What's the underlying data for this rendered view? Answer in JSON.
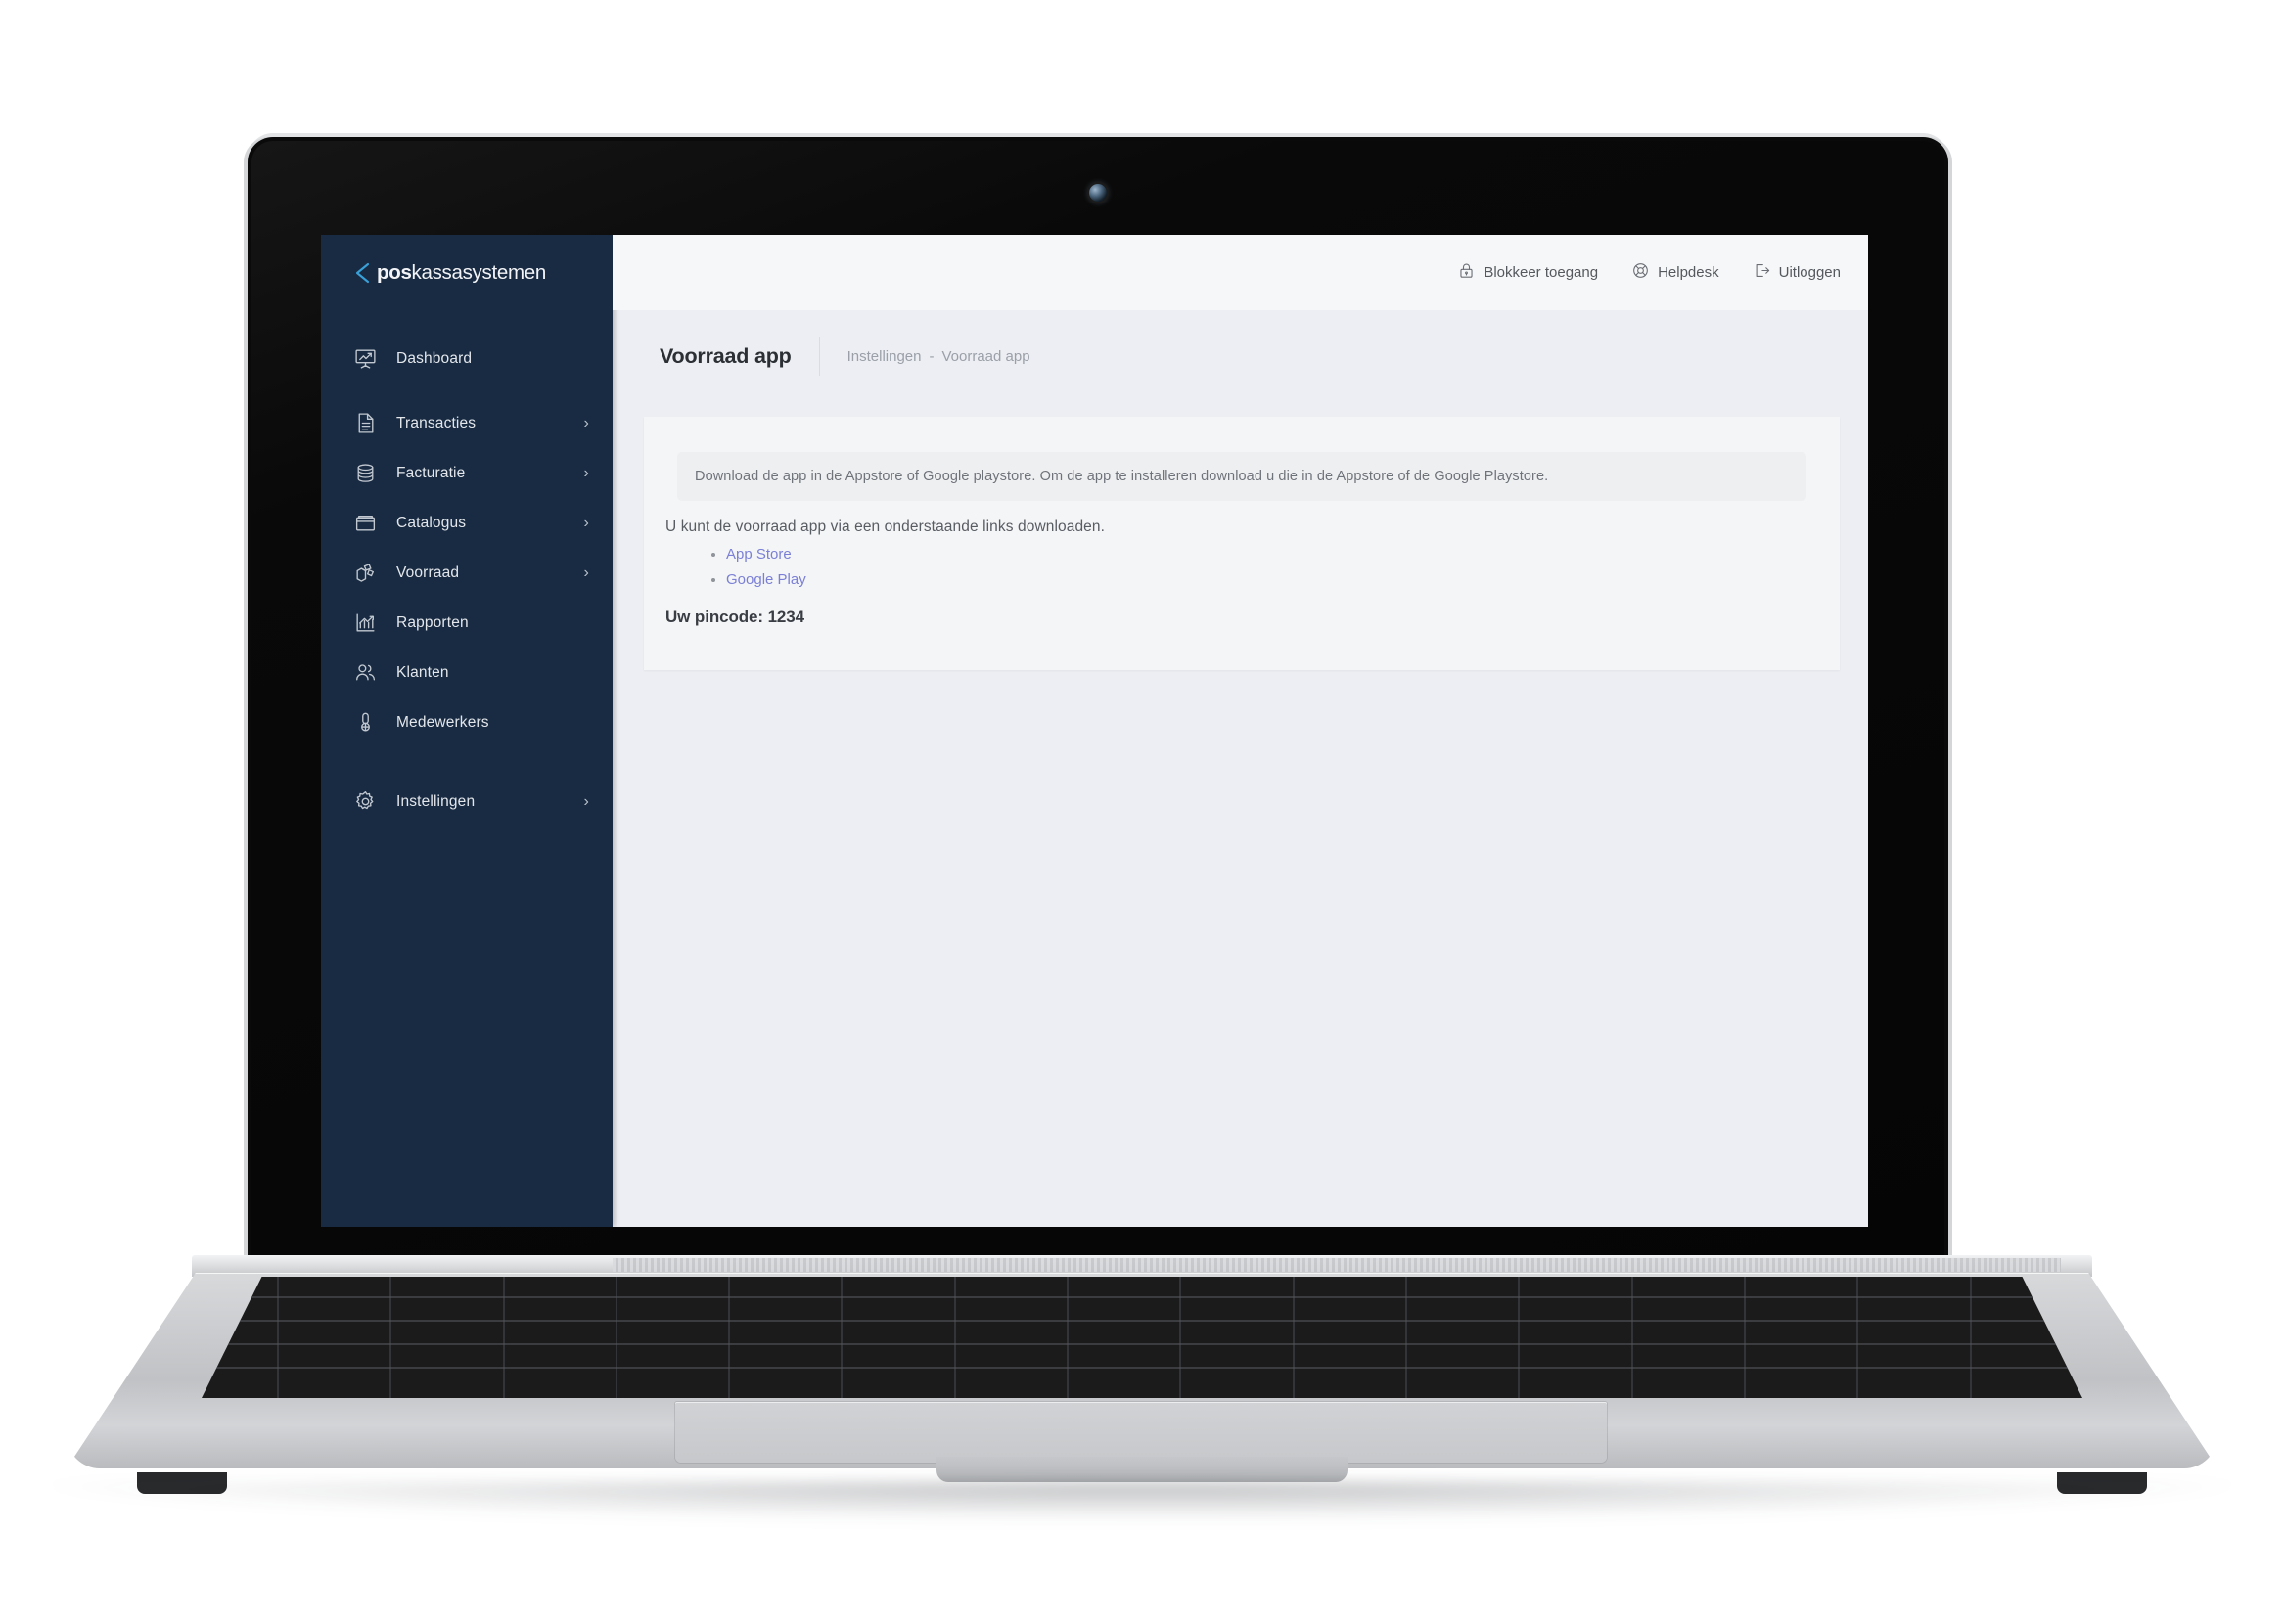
{
  "brand": {
    "bold": "pos",
    "light": "kassasystemen",
    "mark": "chevron-left-diamond-logo"
  },
  "topbar": {
    "items": [
      {
        "label": "Blokkeer toegang",
        "icon": "lock-icon"
      },
      {
        "label": "Helpdesk",
        "icon": "lifebuoy-icon"
      },
      {
        "label": "Uitloggen",
        "icon": "logout-icon"
      }
    ]
  },
  "sidebar": {
    "items": [
      {
        "label": "Dashboard",
        "icon": "presentation-chart-icon",
        "caret": false
      },
      {
        "label": "Transacties",
        "icon": "document-icon",
        "caret": true,
        "caret_glyph": "›"
      },
      {
        "label": "Facturatie",
        "icon": "coins-stack-icon",
        "caret": true,
        "caret_glyph": "›"
      },
      {
        "label": "Catalogus",
        "icon": "folder-box-icon",
        "caret": true,
        "caret_glyph": "›"
      },
      {
        "label": "Voorraad",
        "icon": "open-box-icon",
        "caret": true,
        "caret_glyph": "›"
      },
      {
        "label": "Rapporten",
        "icon": "bar-chart-arrow-icon",
        "caret": false
      },
      {
        "label": "Klanten",
        "icon": "users-icon",
        "caret": false
      },
      {
        "label": "Medewerkers",
        "icon": "employee-badge-icon",
        "caret": false
      },
      {
        "label": "Instellingen",
        "icon": "gear-icon",
        "caret": true,
        "caret_glyph": "›"
      }
    ]
  },
  "page": {
    "title": "Voorraad app",
    "breadcrumb": {
      "parent": "Instellingen",
      "separator": "-",
      "current": "Voorraad app"
    }
  },
  "content": {
    "alert": "Download de app in de Appstore of Google playstore. Om de app te installeren download u die in de Appstore of de Google Playstore.",
    "intro": "U kunt de voorraad app via een onderstaande links downloaden.",
    "links": [
      {
        "label": "App Store"
      },
      {
        "label": "Google Play"
      }
    ],
    "pincode": "Uw pincode: 1234"
  },
  "colors": {
    "sidebar_bg": "#192b42",
    "brand_accent": "#3aa0d8",
    "screen_bg": "#eceef3",
    "topbar_bg": "#f6f7f8",
    "card_bg": "#f4f5f6",
    "link": "#7b80d6",
    "title": "#2c3034"
  }
}
